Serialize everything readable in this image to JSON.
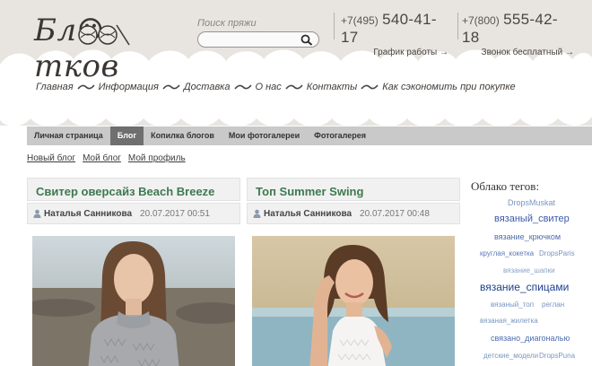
{
  "header": {
    "logo_text": "Бл☺тков",
    "search": {
      "label": "Поиск пряжи",
      "placeholder": ""
    },
    "phones": [
      {
        "code": "+7(495)",
        "number": "540-41-17",
        "sub": "График работы →"
      },
      {
        "code": "+7(800)",
        "number": "555-42-18",
        "sub": "Звонок бесплатный →"
      }
    ]
  },
  "nav": {
    "items": [
      "Главная",
      "Информация",
      "Доставка",
      "О нас",
      "Контакты",
      "Как сэкономить при покупке"
    ]
  },
  "tabs": {
    "items": [
      "Личная страница",
      "Блог",
      "Копилка блогов",
      "Мои фотогалереи",
      "Фотогалерея"
    ],
    "active": "Блог"
  },
  "sublinks": [
    "Новый блог",
    "Мой блог",
    "Мой профиль"
  ],
  "posts": [
    {
      "title": "Свитер оверсайз Beach Breeze",
      "author": "Наталья Санникова",
      "date": "20.07.2017 00:51"
    },
    {
      "title": "Топ Summer Swing",
      "author": "Наталья Санникова",
      "date": "20.07.2017 00:48"
    }
  ],
  "tag_cloud": {
    "title": "Облако тегов:",
    "tags": [
      "DropsMuskat",
      "вязаный_свитер",
      "вязание_крючком",
      "круглая_кокетка",
      "DropsParis",
      "вязание_шапки",
      "вязание_спицами",
      "вязаный_топ",
      "реглан",
      "вязаная_жилетка",
      "связано_диагональю",
      "детские_модели",
      "DropsPuna"
    ]
  },
  "colors": {
    "header_bg": "#e8e4e0",
    "post_title": "#3d7a4e",
    "tag_blue": "#3a5aa8",
    "active_tab": "#6f6f6f"
  }
}
